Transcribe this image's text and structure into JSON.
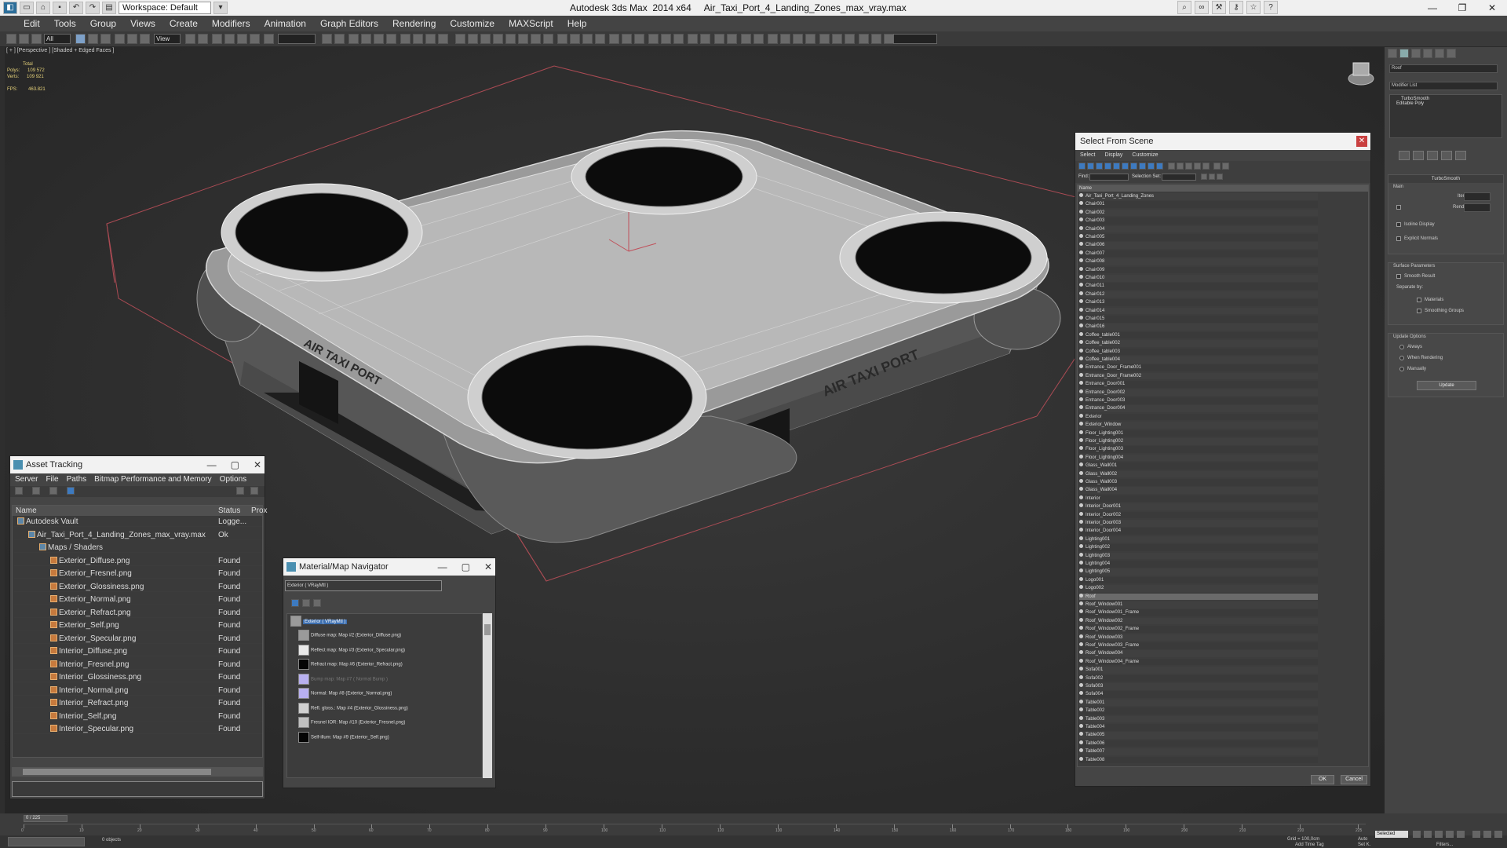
{
  "app": {
    "title": "Autodesk 3ds Max  2014 x64     Air_Taxi_Port_4_Landing_Zones_max_vray.max",
    "workspace": "Workspace: Default"
  },
  "menu": [
    "Edit",
    "Tools",
    "Group",
    "Views",
    "Create",
    "Modifiers",
    "Animation",
    "Graph Editors",
    "Rendering",
    "Customize",
    "MAXScript",
    "Help"
  ],
  "toolbar": {
    "selection_filter": "All",
    "ref_coord": "View"
  },
  "viewport": {
    "label": "[ + ] [Perspective ] [Shaded + Edged Faces ]",
    "stats": {
      "total": "Total",
      "polys_label": "Polys:",
      "polys": "109 572",
      "verts_label": "Verts:",
      "verts": "109 921",
      "fps_label": "FPS:",
      "fps": "463.821"
    },
    "sign_text": "AIR TAXI PORT"
  },
  "command_panel": {
    "object_name": "Roof",
    "modifier_list": "Modifier List",
    "stack": [
      "TurboSmooth",
      "Editable Poly"
    ],
    "turbosmooth": {
      "title": "TurboSmooth",
      "main": "Main",
      "iterations": "Iterations:",
      "render_iters": "Render Iters:",
      "isoline": "Isoline Display",
      "explicit": "Explicit Normals",
      "surface": "Surface Parameters",
      "smooth_result": "Smooth Result",
      "separate": "Separate by:",
      "materials": "Materials",
      "smoothing_groups": "Smoothing Groups",
      "update_options": "Update Options",
      "always": "Always",
      "when_rendering": "When Rendering",
      "manually": "Manually",
      "update": "Update"
    }
  },
  "asset_tracking": {
    "title": "Asset Tracking",
    "menu": [
      "Server",
      "File",
      "Paths",
      "Bitmap Performance and Memory",
      "Options"
    ],
    "columns": [
      "Name",
      "Status",
      "Prox"
    ],
    "rows": [
      {
        "name": "Autodesk Vault",
        "status": "Logge...",
        "indent": 0
      },
      {
        "name": "Air_Taxi_Port_4_Landing_Zones_max_vray.max",
        "status": "Ok",
        "indent": 1
      },
      {
        "name": "Maps / Shaders",
        "status": "",
        "indent": 2
      },
      {
        "name": "Exterior_Diffuse.png",
        "status": "Found",
        "indent": 3
      },
      {
        "name": "Exterior_Fresnel.png",
        "status": "Found",
        "indent": 3
      },
      {
        "name": "Exterior_Glossiness.png",
        "status": "Found",
        "indent": 3
      },
      {
        "name": "Exterior_Normal.png",
        "status": "Found",
        "indent": 3
      },
      {
        "name": "Exterior_Refract.png",
        "status": "Found",
        "indent": 3
      },
      {
        "name": "Exterior_Self.png",
        "status": "Found",
        "indent": 3
      },
      {
        "name": "Exterior_Specular.png",
        "status": "Found",
        "indent": 3
      },
      {
        "name": "Interior_Diffuse.png",
        "status": "Found",
        "indent": 3
      },
      {
        "name": "Interior_Fresnel.png",
        "status": "Found",
        "indent": 3
      },
      {
        "name": "Interior_Glossiness.png",
        "status": "Found",
        "indent": 3
      },
      {
        "name": "Interior_Normal.png",
        "status": "Found",
        "indent": 3
      },
      {
        "name": "Interior_Refract.png",
        "status": "Found",
        "indent": 3
      },
      {
        "name": "Interior_Self.png",
        "status": "Found",
        "indent": 3
      },
      {
        "name": "Interior_Specular.png",
        "status": "Found",
        "indent": 3
      }
    ]
  },
  "material_navigator": {
    "title": "Material/Map Navigator",
    "current": "Exterior  ( VRayMtl )",
    "root": "Exterior  ( VRayMtl )",
    "items": [
      {
        "label": "Diffuse map: Map #2 (Exterior_Diffuse.png)",
        "swatch": "#9a9a9a"
      },
      {
        "label": "Reflect map: Map #3 (Exterior_Specular.png)",
        "swatch": "#e8e8e8"
      },
      {
        "label": "Refract map: Map #6 (Exterior_Refract.png)",
        "swatch": "#050505"
      },
      {
        "label": "Bump map: Map #7 ( Normal Bump )",
        "swatch": "#b8b0f0"
      },
      {
        "label": "Normal: Map #8 (Exterior_Normal.png)",
        "swatch": "#b8b0f0"
      },
      {
        "label": "Refl. gloss.: Map #4 (Exterior_Glossiness.png)",
        "swatch": "#d0d0d0"
      },
      {
        "label": "Fresnel IOR: Map #10 (Exterior_Fresnel.png)",
        "swatch": "#c0c0c0"
      },
      {
        "label": "Self-illum: Map #9 (Exterior_Self.png)",
        "swatch": "#050505"
      }
    ]
  },
  "select_from_scene": {
    "title": "Select From Scene",
    "menu": [
      "Select",
      "Display",
      "Customize"
    ],
    "find_label": "Find:",
    "selection_set": "Selection Set:",
    "column": "Name",
    "objects": [
      "Air_Taxi_Port_4_Landing_Zones",
      "Chair001",
      "Chair002",
      "Chair003",
      "Chair004",
      "Chair005",
      "Chair006",
      "Chair007",
      "Chair008",
      "Chair009",
      "Chair010",
      "Chair011",
      "Chair012",
      "Chair013",
      "Chair014",
      "Chair015",
      "Chair016",
      "Coffee_table001",
      "Coffee_table002",
      "Coffee_table003",
      "Coffee_table004",
      "Entrance_Door_Frame001",
      "Entrance_Door_Frame002",
      "Entrance_Door001",
      "Entrance_Door002",
      "Entrance_Door003",
      "Entrance_Door004",
      "Exterior",
      "Exterior_Window",
      "Floor_Lighting001",
      "Floor_Lighting002",
      "Floor_Lighting003",
      "Floor_Lighting004",
      "Glass_Wall001",
      "Glass_Wall002",
      "Glass_Wall003",
      "Glass_Wall004",
      "Interior",
      "Interior_Door001",
      "Interior_Door002",
      "Interior_Door003",
      "Interior_Door004",
      "Lighting001",
      "Lighting002",
      "Lighting003",
      "Lighting004",
      "Lighting005",
      "Logo001",
      "Logo002",
      "Roof",
      "Roof_Window001",
      "Roof_Window001_Frame",
      "Roof_Window002",
      "Roof_Window002_Frame",
      "Roof_Window003",
      "Roof_Window003_Frame",
      "Roof_Window004",
      "Roof_Window004_Frame",
      "Sofa001",
      "Sofa002",
      "Sofa003",
      "Sofa004",
      "Table001",
      "Table002",
      "Table003",
      "Table004",
      "Table005",
      "Table006",
      "Table007",
      "Table008"
    ],
    "selected": "Roof",
    "ok": "OK",
    "cancel": "Cancel"
  },
  "timeline": {
    "frame": "0 / 225",
    "ticks": [
      "0",
      "10",
      "20",
      "30",
      "40",
      "50",
      "60",
      "70",
      "80",
      "90",
      "100",
      "110",
      "120",
      "130",
      "140",
      "150",
      "160",
      "170",
      "180",
      "190",
      "200",
      "210",
      "220",
      "225"
    ],
    "grid": "Grid = 100,0cm",
    "auto": "Auto",
    "selected": "Selected",
    "set_key": "Set K.",
    "filters": "Filters...",
    "add_time_tag": "Add Time Tag",
    "status": "0 objects"
  }
}
